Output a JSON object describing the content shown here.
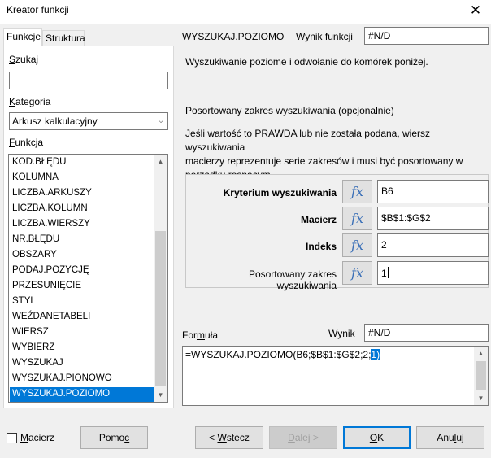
{
  "window": {
    "title": "Kreator funkcji",
    "close_glyph": "✕"
  },
  "tabs": [
    {
      "label": "Funkcje",
      "active": true
    },
    {
      "label": "Struktura",
      "active": false
    }
  ],
  "left": {
    "search_label": "Szukaj",
    "search_value": "",
    "category_label": "Kategoria",
    "category_value": "Arkusz kalkulacyjny",
    "function_label": "Funkcja",
    "functions": [
      "KOD.BŁĘDU",
      "KOLUMNA",
      "LICZBA.ARKUSZY",
      "LICZBA.KOLUMN",
      "LICZBA.WIERSZY",
      "NR.BŁĘDU",
      "OBSZARY",
      "PODAJ.POZYCJĘ",
      "PRZESUNIĘCIE",
      "STYL",
      "WEŹDANETABELI",
      "WIERSZ",
      "WYBIERZ",
      "WYSZUKAJ",
      "WYSZUKAJ.PIONOWO",
      "WYSZUKAJ.POZIOMO"
    ],
    "selected_index": 15
  },
  "right": {
    "function_name": "WYSZUKAJ.POZIOMO",
    "result_label": "Wynik funkcji",
    "result_value": "#N/D",
    "description": "Wyszukiwanie poziome i odwołanie do komórek poniżej.",
    "arg_title": "Posortowany zakres wyszukiwania (opcjonalnie)",
    "arg_help": [
      "Jeśli wartość to PRAWDA lub nie została podana, wiersz wyszukiwania",
      "macierzy reprezentuje serie zakresów i musi być posortowany w",
      "porządku rosnącym."
    ],
    "fx_glyph": "fx",
    "args": [
      {
        "label": "Kryterium wyszukiwania",
        "value": "B6",
        "bold": true
      },
      {
        "label": "Macierz",
        "value": "$B$1:$G$2",
        "bold": true
      },
      {
        "label": "Indeks",
        "value": "2",
        "bold": true
      },
      {
        "label": "Posortowany zakres wyszukiwania",
        "value": "1",
        "bold": false
      }
    ],
    "formula_label": "Formuła",
    "formula_result_label": "Wynik",
    "formula_result_value": "#N/D",
    "formula_text_pre": "=WYSZUKAJ.POZIOMO(B6;$B$1:$G$2;2;",
    "formula_text_sel": "1)"
  },
  "footer": {
    "array_label": "Macierz",
    "array_checked": false,
    "help_label": "Pomoc",
    "back_label": "< Wstecz",
    "next_label": "Dalej >",
    "ok_label": "OK",
    "cancel_label": "Anuluj"
  },
  "colors": {
    "selection": "#0078d7",
    "fx": "#3a6fb7"
  }
}
